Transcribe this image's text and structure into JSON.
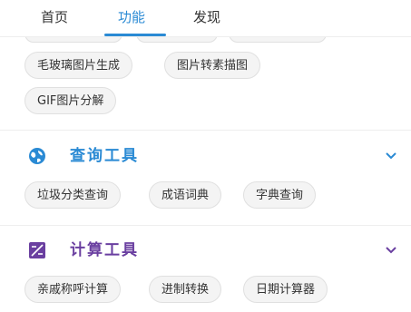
{
  "tabs": {
    "home": "首页",
    "functions": "功能",
    "discover": "发现",
    "active_color": "#2a8ad4"
  },
  "section_image": {
    "items": [
      "毛玻璃图片生成",
      "图片转素描图",
      "GIF图片分解"
    ]
  },
  "section_query": {
    "title": "查询工具",
    "icon": "globe-icon",
    "color": "#2a8ad4",
    "items": [
      "垃圾分类查询",
      "成语词典",
      "字典查询"
    ]
  },
  "section_calc": {
    "title": "计算工具",
    "icon": "calculator-icon",
    "color": "#6a3fa0",
    "items": [
      "亲戚称呼计算",
      "进制转换",
      "日期计算器"
    ]
  }
}
